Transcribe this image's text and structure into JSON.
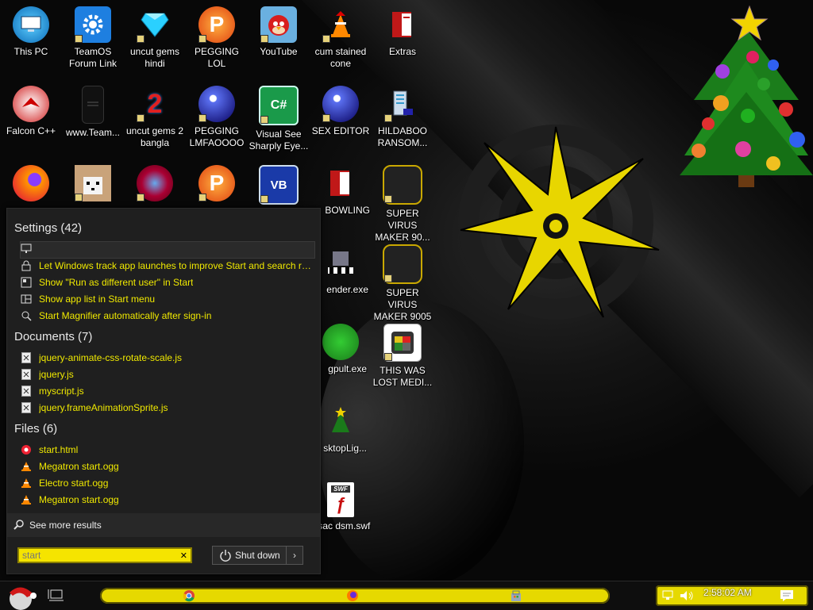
{
  "desktop": {
    "icons": [
      {
        "label": "This PC"
      },
      {
        "label": "TeamOS Forum Link"
      },
      {
        "label": "uncut gems hindi"
      },
      {
        "label": "PEGGING LOL"
      },
      {
        "label": "YouTube"
      },
      {
        "label": "cum stained cone"
      },
      {
        "label": "Extras"
      },
      {
        "label": "Falcon C++"
      },
      {
        "label": "www.Team..."
      },
      {
        "label": "uncut gems 2 bangla"
      },
      {
        "label": "PEGGING LMFAOOOO"
      },
      {
        "label": "Visual See Sharply Eye..."
      },
      {
        "label": "SEX EDITOR"
      },
      {
        "label": "HILDABOO RANSOM..."
      },
      {
        "label": "BOWLING"
      },
      {
        "label": "SUPER VIRUS MAKER 90..."
      },
      {
        "label": "ender.exe"
      },
      {
        "label": "SUPER VIRUS MAKER 9005"
      },
      {
        "label": "gpult.exe"
      },
      {
        "label": "THIS WAS LOST MEDI..."
      },
      {
        "label": "sktopLig..."
      },
      {
        "label": "issac dsm.swf"
      }
    ]
  },
  "search_panel": {
    "settings": {
      "heading": "Settings (42)",
      "items": [
        {
          "label": "Let Windows track app launches to improve Start and search re..."
        },
        {
          "label": "Show \"Run as different user\" in Start"
        },
        {
          "label": "Show app list in Start menu"
        },
        {
          "label": "Start Magnifier automatically after sign-in"
        }
      ]
    },
    "documents": {
      "heading": "Documents (7)",
      "items": [
        {
          "label": "jquery-animate-css-rotate-scale.js"
        },
        {
          "label": "jquery.js"
        },
        {
          "label": "myscript.js"
        },
        {
          "label": "jquery.frameAnimationSprite.js"
        }
      ]
    },
    "files": {
      "heading": "Files (6)",
      "items": [
        {
          "label": "start.html"
        },
        {
          "label": "Megatron start.ogg"
        },
        {
          "label": "Electro start.ogg"
        },
        {
          "label": "Megatron start.ogg"
        }
      ]
    },
    "see_more": "See more results",
    "search_value": "start",
    "clear": "✕",
    "shutdown": "Shut down",
    "shutdown_arrow": "›"
  },
  "taskbar": {
    "clock": "2:58:02 AM"
  },
  "colors": {
    "accent": "#f0e900",
    "panel_bg": "#1f1f1f"
  }
}
